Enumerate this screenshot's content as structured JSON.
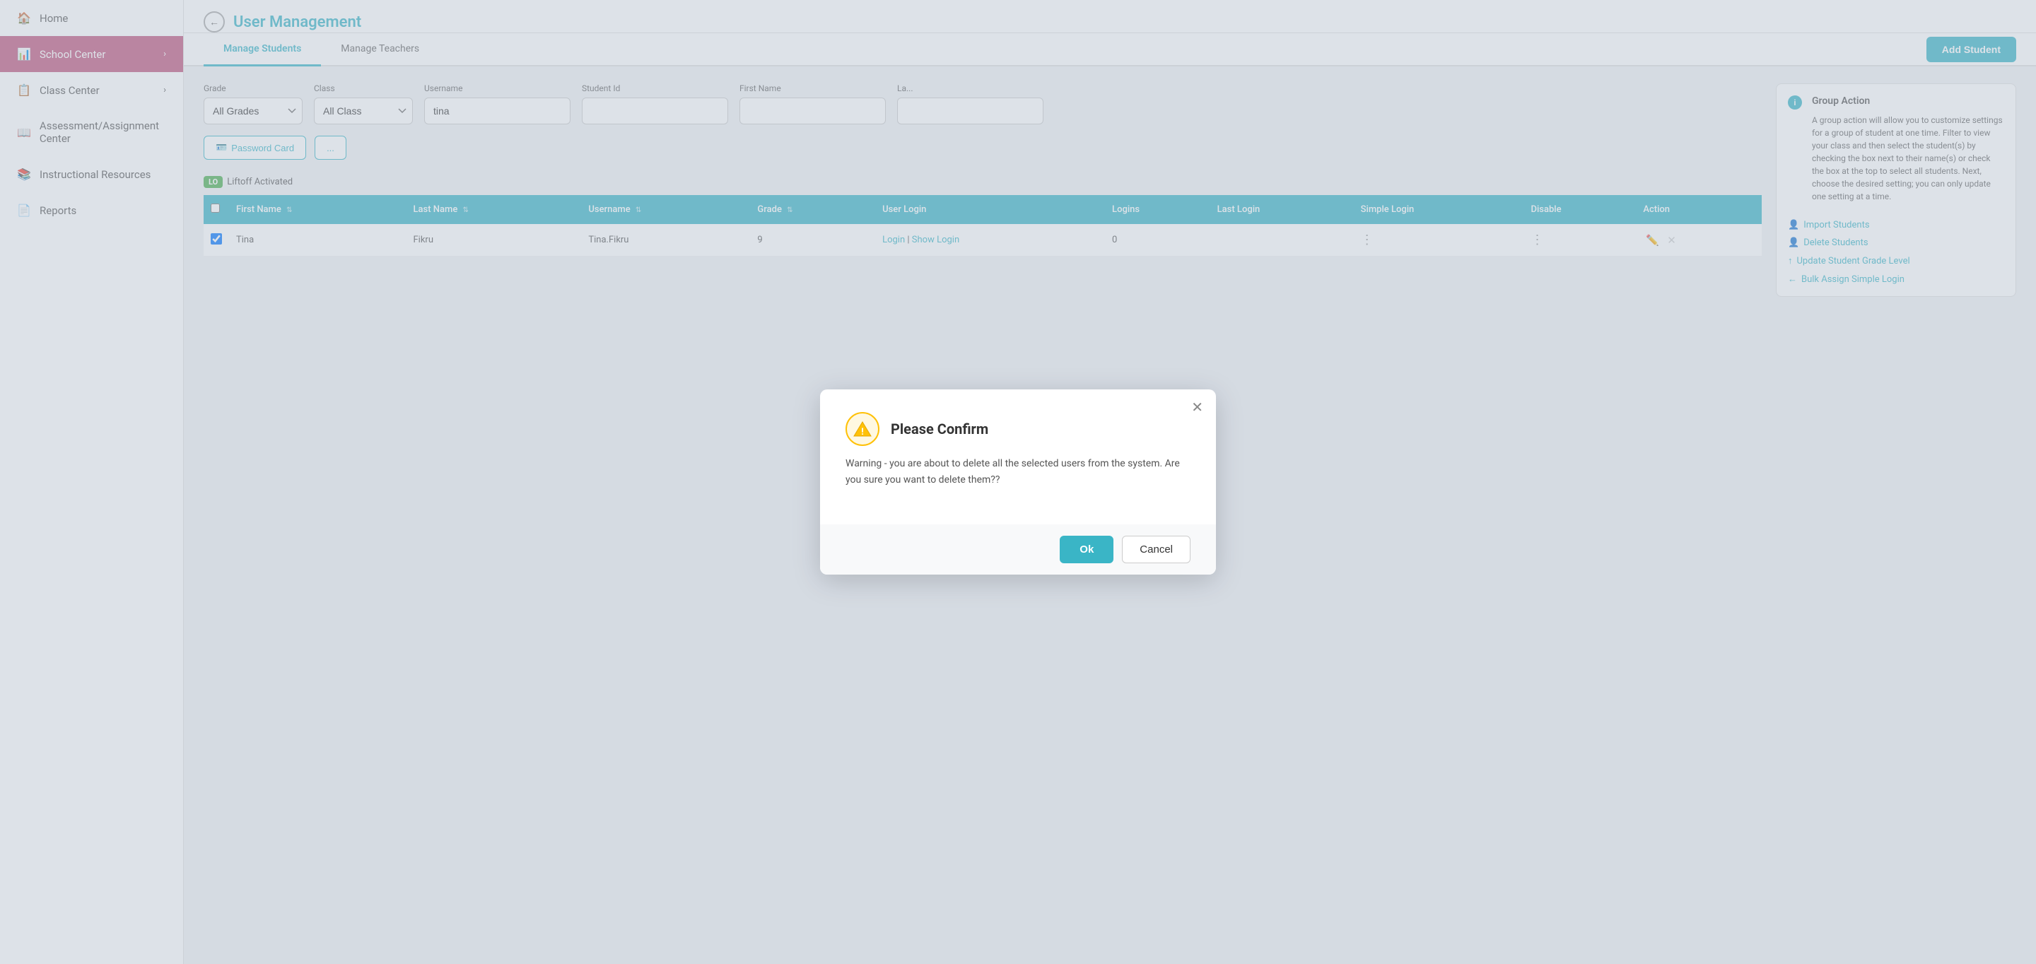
{
  "sidebar": {
    "items": [
      {
        "id": "home",
        "label": "Home",
        "icon": "🏠",
        "active": false
      },
      {
        "id": "school-center",
        "label": "School Center",
        "icon": "📊",
        "active": true,
        "hasChevron": true
      },
      {
        "id": "class-center",
        "label": "Class Center",
        "icon": "📋",
        "active": false,
        "hasChevron": true
      },
      {
        "id": "assessment-center",
        "label": "Assessment/Assignment Center",
        "icon": "📖",
        "active": false
      },
      {
        "id": "instructional-resources",
        "label": "Instructional Resources",
        "icon": "📚",
        "active": false
      },
      {
        "id": "reports",
        "label": "Reports",
        "icon": "📄",
        "active": false
      }
    ]
  },
  "header": {
    "title": "User Management",
    "back_label": "←"
  },
  "tabs": [
    {
      "id": "manage-students",
      "label": "Manage Students",
      "active": true
    },
    {
      "id": "manage-teachers",
      "label": "Manage Teachers",
      "active": false
    }
  ],
  "filters": {
    "grade_label": "Grade",
    "grade_value": "All Grades",
    "class_label": "Class",
    "class_value": "All Class",
    "username_label": "Username",
    "username_value": "tina",
    "student_id_label": "Student Id",
    "student_id_value": "",
    "first_name_label": "First Name",
    "first_name_value": "",
    "last_name_label": "La..."
  },
  "add_student_btn": "Add Student",
  "action_buttons": [
    {
      "id": "password-card",
      "label": "Password Card",
      "icon": "🪪"
    },
    {
      "id": "other",
      "label": "..."
    }
  ],
  "group_action": {
    "title": "Group Action",
    "description": "A group action will allow you to customize settings for a group of student at one time. Filter to view your class and then select the student(s) by checking the box next to their name(s) or check the box at the top to select all students. Next, choose the desired setting; you can only update one setting at a time.",
    "links": [
      {
        "id": "import-students",
        "label": "Import Students",
        "icon": "👤+"
      },
      {
        "id": "delete-students",
        "label": "Delete Students",
        "icon": "👤-"
      },
      {
        "id": "update-grade",
        "label": "Update Student Grade Level",
        "icon": "↑"
      },
      {
        "id": "bulk-assign",
        "label": "Bulk Assign Simple Login",
        "icon": "←"
      }
    ]
  },
  "liftoff": {
    "tag": "LO",
    "text": "Liftoff Activated"
  },
  "table": {
    "columns": [
      {
        "id": "checkbox",
        "label": ""
      },
      {
        "id": "first-name",
        "label": "First Name"
      },
      {
        "id": "last-name",
        "label": "Last Name"
      },
      {
        "id": "username",
        "label": "Username"
      },
      {
        "id": "grade",
        "label": "Grade"
      },
      {
        "id": "user-login",
        "label": "User Login"
      },
      {
        "id": "logins",
        "label": "Logins"
      },
      {
        "id": "last-login",
        "label": "Last Login"
      },
      {
        "id": "simple-login",
        "label": "Simple Login"
      },
      {
        "id": "disable",
        "label": "Disable"
      },
      {
        "id": "action",
        "label": "Action"
      }
    ],
    "rows": [
      {
        "checkbox": true,
        "first_name": "Tina",
        "last_name": "Fikru",
        "username": "Tina.Fikru",
        "grade": "9",
        "login_link": "Login",
        "show_login_link": "Show Login",
        "logins": "0",
        "last_login": "",
        "simple_login": "",
        "disable": "",
        "action": ""
      }
    ]
  },
  "modal": {
    "title": "Please Confirm",
    "description": "Warning - you are about to delete all the selected users from the system. Are you sure you want to delete them??",
    "ok_label": "Ok",
    "cancel_label": "Cancel",
    "close_icon": "✕"
  }
}
